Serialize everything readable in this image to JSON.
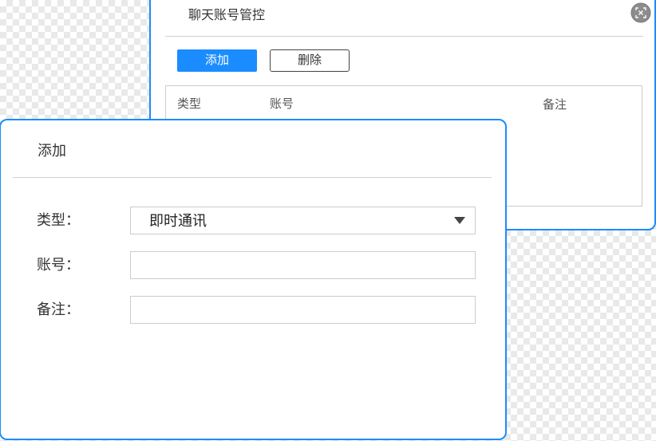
{
  "colors": {
    "accent": "#1a8cff",
    "dialog_border": "#1a8cff",
    "divider": "#cfcfcf"
  },
  "back_dialog": {
    "title": "聊天账号管控",
    "close_icon": "close-icon",
    "add_label": "添加",
    "delete_label": "删除",
    "table_headers": [
      "类型",
      "账号",
      "备注"
    ]
  },
  "add_dialog": {
    "title": "添加",
    "dropdown_icon": "chevron-down-icon",
    "fields": [
      {
        "label": "类型：",
        "value": "即时通讯"
      },
      {
        "label": "账号：",
        "value": ""
      },
      {
        "label": "备注：",
        "value": ""
      }
    ]
  }
}
